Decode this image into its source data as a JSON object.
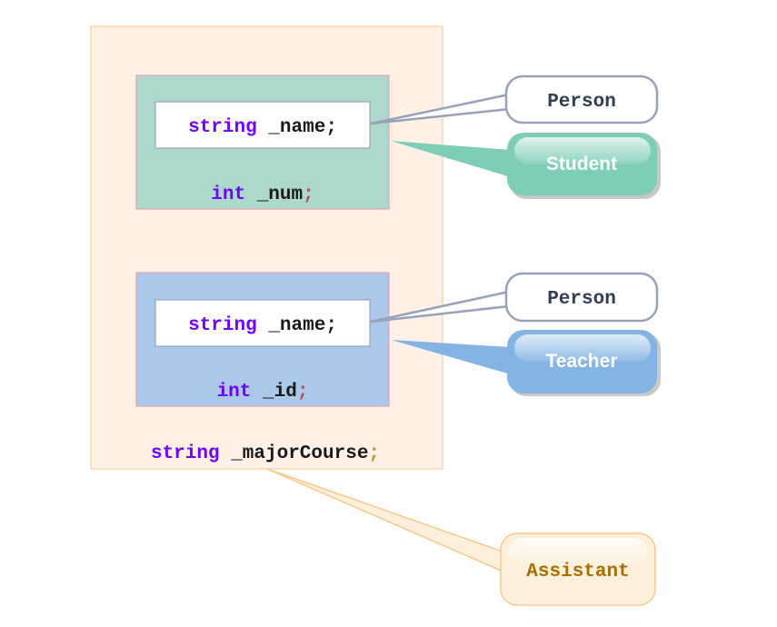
{
  "assistant": {
    "field_type": "string",
    "field_name": " _majorCourse",
    "semicolon": ";",
    "label": "Assistant"
  },
  "student": {
    "inherited": {
      "type": "string",
      "name": " _name;"
    },
    "field_type": "int",
    "field_name": " _num",
    "semicolon": ";",
    "base_label": "Person",
    "label": "Student"
  },
  "teacher": {
    "inherited": {
      "type": "string",
      "name": " _name;"
    },
    "field_type": "int",
    "field_name": " _id",
    "semicolon": ";",
    "base_label": "Person",
    "label": "Teacher"
  },
  "colors": {
    "assistant_fill": "#fff1e6",
    "student_fill": "#acd9cc",
    "teacher_fill": "#a9c8ea",
    "student_callout": "#7ecdb6",
    "teacher_callout": "#84b4e4",
    "keyword": "#7000ff"
  }
}
